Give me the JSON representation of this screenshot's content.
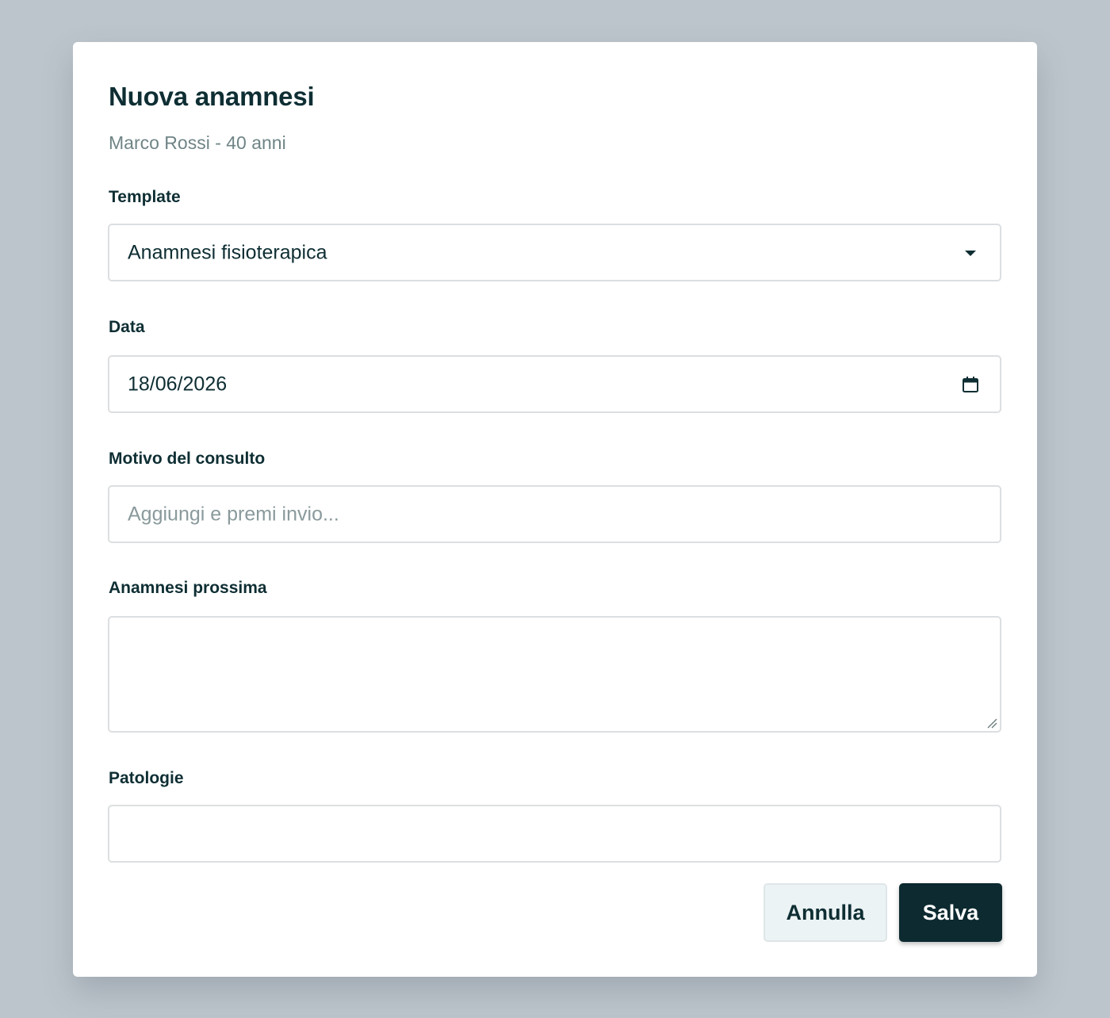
{
  "modal": {
    "title": "Nuova anamnesi",
    "subtitle": "Marco Rossi - 40 anni"
  },
  "fields": {
    "template": {
      "label": "Template",
      "value": "Anamnesi fisioterapica"
    },
    "date": {
      "label": "Data",
      "value": "18/06/2026"
    },
    "reason": {
      "label": "Motivo del consulto",
      "value": "",
      "placeholder": "Aggiungi e premi invio..."
    },
    "history": {
      "label": "Anamnesi prossima",
      "value": ""
    },
    "pathologies": {
      "label": "Patologie",
      "value": ""
    }
  },
  "actions": {
    "cancel_label": "Annulla",
    "save_label": "Salva"
  },
  "icons": {
    "template_dropdown": "chevron-down-icon",
    "date_picker": "calendar-icon",
    "textarea_resize": "resize-handle-icon"
  },
  "colors": {
    "overlay": "#bdc5cc",
    "primary": "#0c2a2f",
    "text": "#0e2e33",
    "muted": "#6f8486",
    "cancel_bg": "#ecf3f4"
  }
}
